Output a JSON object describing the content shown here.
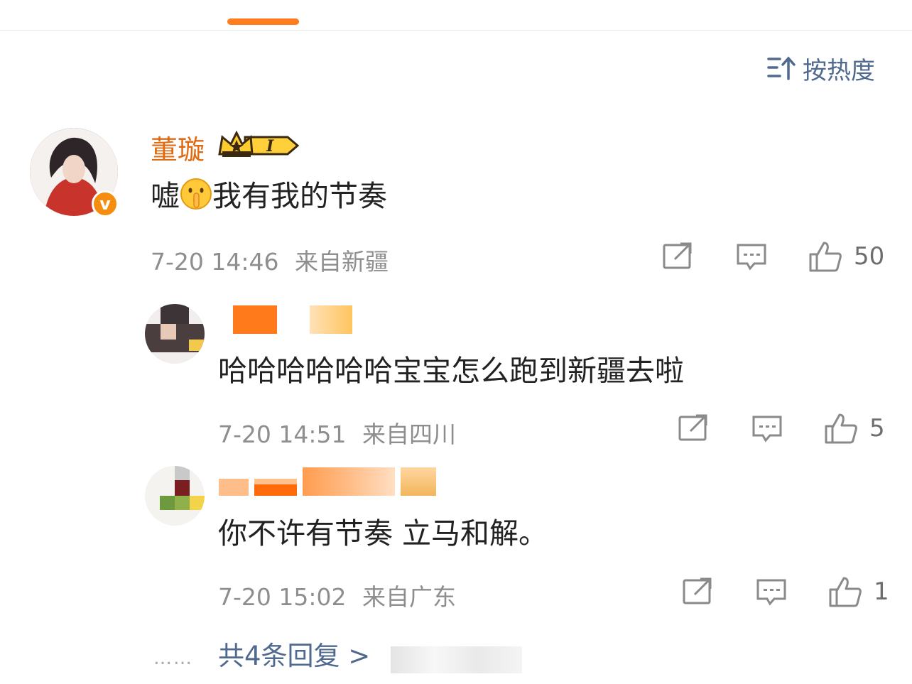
{
  "sort": {
    "label": "按热度",
    "icon": "sort-icon"
  },
  "colors": {
    "accent": "#ff7c1f",
    "link": "#50698f",
    "username": "#e06a10",
    "meta": "#8e8e8e"
  },
  "comment": {
    "username": "董璇",
    "level_badge": "I",
    "text_before_emoji": "嘘",
    "emoji": "shush-emoji",
    "text_after_emoji": "我有我的节奏",
    "time": "7-20 14:46",
    "location": "来自新疆",
    "likes": "50"
  },
  "replies": [
    {
      "text": "哈哈哈哈哈哈宝宝怎么跑到新疆去啦",
      "time": "7-20 14:51",
      "location": "来自四川",
      "likes": "5"
    },
    {
      "text": "你不许有节奏 立马和解。",
      "time": "7-20 15:02",
      "location": "来自广东",
      "likes": "1"
    }
  ],
  "more": {
    "dots": "……",
    "label": "共4条回复 >"
  }
}
